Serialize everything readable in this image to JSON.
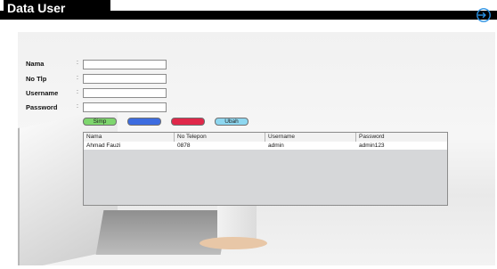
{
  "window": {
    "title": "Data User",
    "exit_icon": "exit-icon"
  },
  "form": {
    "fields": [
      {
        "label": "Nama",
        "value": ""
      },
      {
        "label": "No Tlp",
        "value": ""
      },
      {
        "label": "Username",
        "value": ""
      },
      {
        "label": "Password",
        "value": ""
      }
    ],
    "colon": ":"
  },
  "buttons": {
    "simp": "Simp",
    "blue": "",
    "red": "",
    "ubah": "Ubah"
  },
  "table": {
    "headers": [
      "Nama",
      "No Telepon",
      "Username",
      "Password"
    ],
    "rows": [
      [
        "Ahmad Fauzi",
        "0878",
        "admin",
        "admin123"
      ]
    ]
  }
}
